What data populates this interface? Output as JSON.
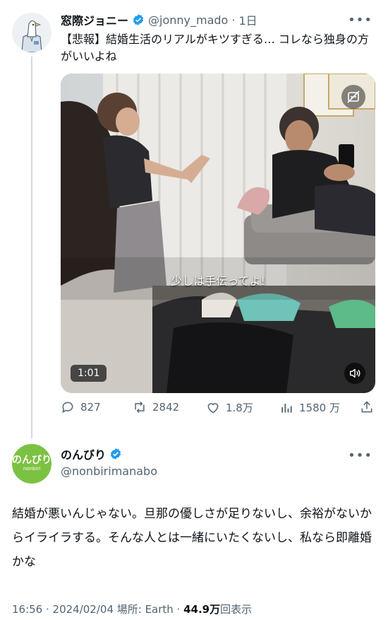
{
  "tweet1": {
    "name": "窓際ジョニー",
    "handle": "@jonny_mado",
    "sep": "·",
    "time": "1日",
    "text": "【悲報】結婚生活のリアルがキツすぎる… コレなら独身の方がいいよね",
    "video": {
      "caption": "少しは手伝ってよ!",
      "duration": "1:01"
    },
    "stats": {
      "replies": "827",
      "retweets": "2842",
      "likes": "1.8万",
      "views": "1580 万"
    }
  },
  "tweet2": {
    "name": "のんびり",
    "handle": "@nonbirimanabo",
    "avatar_text": "のんびり",
    "avatar_subtext": "nonbiri",
    "text": "結婚が悪いんじゃない。旦那の優しさが足りないし、余裕がないからイライラする。そんな人とは一緒にいたくないし、私なら即離婚かな",
    "meta": {
      "time": "16:56 · 2024/02/04 場所: Earth · ",
      "views_count": "44.9万",
      "views_label": "回表示"
    }
  },
  "colors": {
    "verified": "#1d9bf0",
    "secondary_text": "#536471",
    "avatar2_bg": "#7cc242"
  }
}
